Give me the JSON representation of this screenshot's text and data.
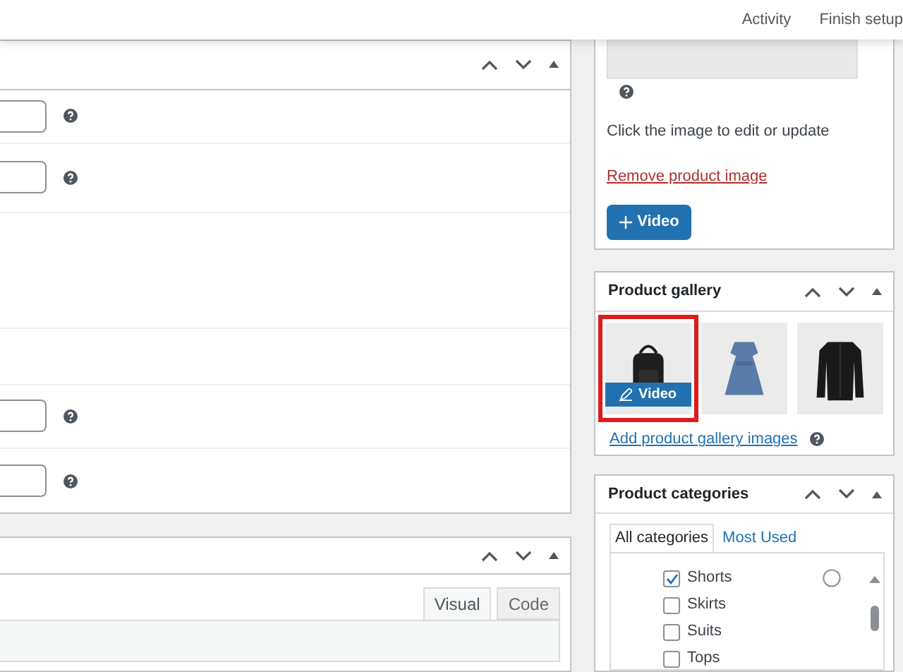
{
  "top_bar": {
    "items": [
      {
        "label": "Activity"
      },
      {
        "label": "Finish setup"
      }
    ]
  },
  "main_panel": {
    "rows": [
      {
        "kind": "field"
      },
      {
        "kind": "field"
      },
      {
        "kind": "blank"
      },
      {
        "kind": "blank"
      },
      {
        "kind": "field"
      },
      {
        "kind": "field"
      }
    ]
  },
  "description_panel": {
    "tabs": [
      {
        "label": "Visual",
        "selected": true
      },
      {
        "label": "Code",
        "selected": false
      }
    ]
  },
  "product_image": {
    "hint": "Click the image to edit or update",
    "remove_link": "Remove product image",
    "video_button": "Video"
  },
  "product_gallery": {
    "title": "Product gallery",
    "items": [
      {
        "kind": "backpack",
        "highlighted": true,
        "video_button": "Video"
      },
      {
        "kind": "dress",
        "highlighted": false
      },
      {
        "kind": "jacket",
        "highlighted": false
      }
    ],
    "add_link": "Add product gallery images"
  },
  "product_categories": {
    "title": "Product categories",
    "tabs": [
      {
        "label": "All categories",
        "selected": true
      },
      {
        "label": "Most Used",
        "selected": false
      }
    ],
    "items": [
      {
        "label": "Shorts",
        "checked": true
      },
      {
        "label": "Skirts",
        "checked": false
      },
      {
        "label": "Suits",
        "checked": false
      },
      {
        "label": "Tops",
        "checked": false
      }
    ]
  }
}
